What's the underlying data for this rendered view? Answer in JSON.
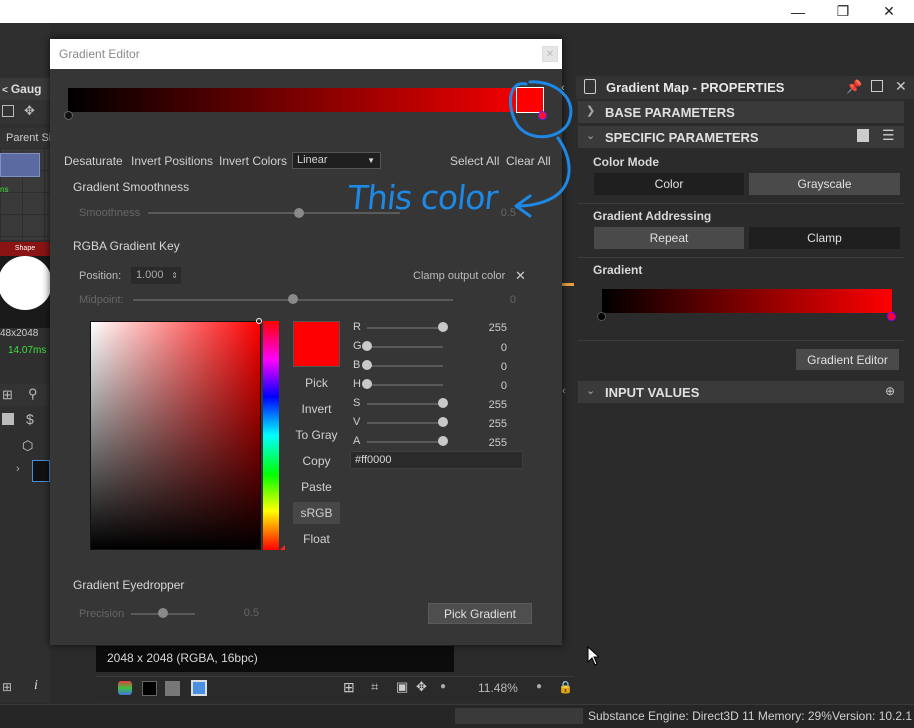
{
  "window_controls": {
    "minimize": "—",
    "maximize": "❐",
    "close": "✕"
  },
  "left_panel": {
    "header": "Gaug",
    "parent_label": "Parent Si",
    "shape_label": "Shape",
    "size_label": "48x2048",
    "time_label": "14.07ms"
  },
  "viewport": {
    "resolution_label": "2048 x 2048 (RGBA, 16bpc)",
    "zoom": "11.48%"
  },
  "status_bar": {
    "engine": "Substance Engine: Direct3D 11  Memory: 29%",
    "version": "Version: 10.2.1"
  },
  "properties": {
    "title": "Gradient Map - PROPERTIES",
    "base_parameters": "BASE PARAMETERS",
    "specific_parameters": "SPECIFIC PARAMETERS",
    "color_mode": {
      "label": "Color Mode",
      "options": [
        "Color",
        "Grayscale"
      ],
      "selected": "Color"
    },
    "gradient_addressing": {
      "label": "Gradient Addressing",
      "options": [
        "Repeat",
        "Clamp"
      ],
      "selected": "Clamp"
    },
    "gradient_label": "Gradient",
    "gradient_editor_button": "Gradient Editor",
    "input_values": "INPUT VALUES",
    "gradient_colors": {
      "start": "#000000",
      "end": "#ff0000"
    }
  },
  "gradient_editor": {
    "title": "Gradient Editor",
    "toolbar": {
      "desaturate": "Desaturate",
      "invert_positions": "Invert Positions",
      "invert_colors": "Invert Colors",
      "interpolation": "Linear",
      "select_all": "Select All",
      "clear_all": "Clear All"
    },
    "smoothness": {
      "heading": "Gradient Smoothness",
      "label": "Smoothness",
      "value": "0.5",
      "fraction": 0.6
    },
    "rgba_key": {
      "heading": "RGBA Gradient Key",
      "position_label": "Position:",
      "position_value": "1.000",
      "clamp_label": "Clamp output color",
      "clamp_icon": "✕",
      "midpoint_label": "Midpoint:",
      "midpoint_value": "0",
      "midpoint_fraction": 0.5
    },
    "color_buttons": [
      "Pick",
      "Invert",
      "To Gray",
      "Copy",
      "Paste",
      "sRGB",
      "Float"
    ],
    "active_color_button": "sRGB",
    "channels": [
      {
        "label": "R",
        "value": "255",
        "fraction": 1.0
      },
      {
        "label": "G",
        "value": "0",
        "fraction": 0.0
      },
      {
        "label": "B",
        "value": "0",
        "fraction": 0.0
      },
      {
        "label": "H",
        "value": "0",
        "fraction": 0.0
      },
      {
        "label": "S",
        "value": "255",
        "fraction": 1.0
      },
      {
        "label": "V",
        "value": "255",
        "fraction": 1.0
      },
      {
        "label": "A",
        "value": "255",
        "fraction": 1.0
      }
    ],
    "hex": "#ff0000",
    "selected_color": "#ff0000",
    "eyedropper": {
      "heading": "Gradient Eyedropper",
      "precision_label": "Precision",
      "precision_value": "0.5",
      "precision_fraction": 0.5,
      "pick_button": "Pick Gradient"
    }
  },
  "annotation": {
    "text": "This color",
    "color": "#1e88e5"
  }
}
